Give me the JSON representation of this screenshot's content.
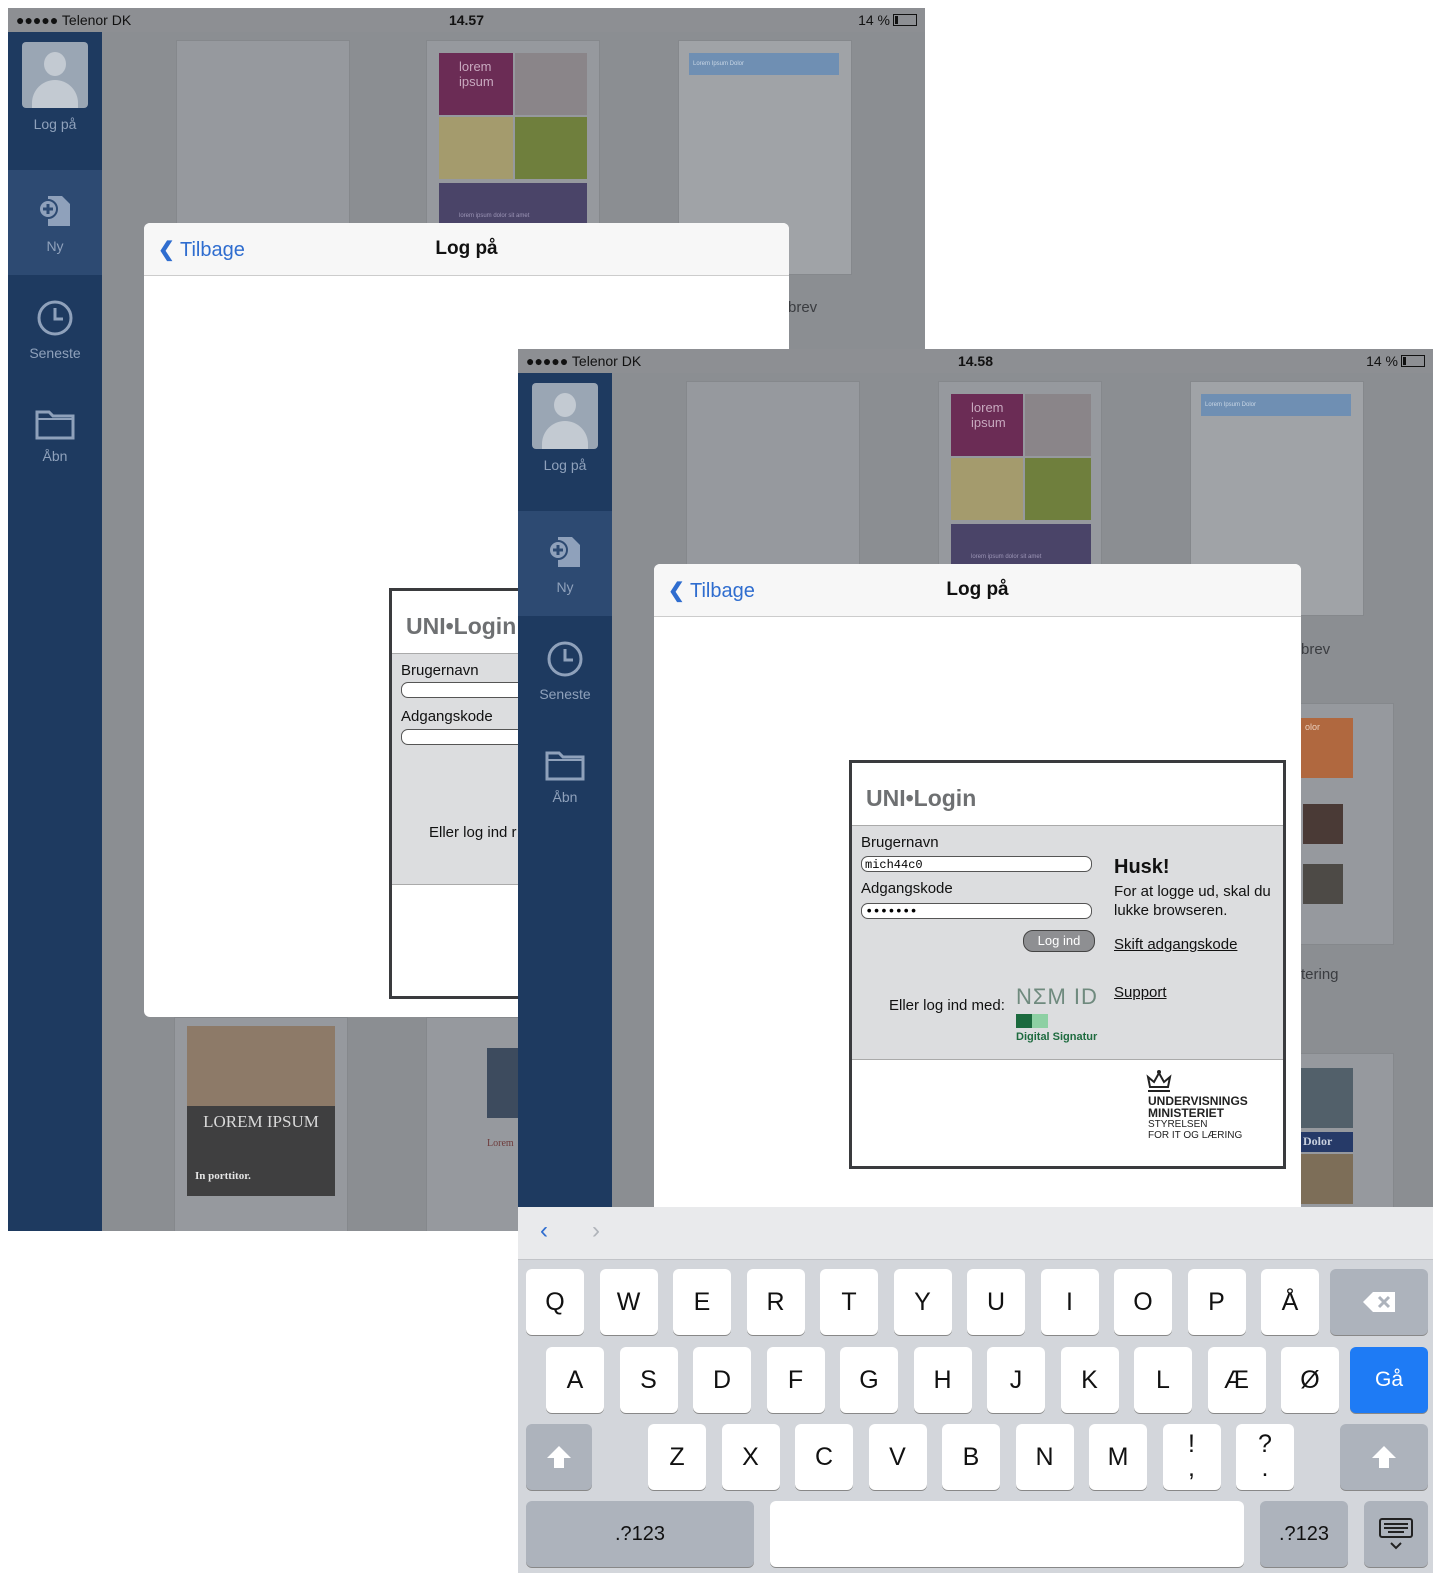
{
  "back_screenshot": {
    "status": {
      "carrier": "●●●●● Telenor DK",
      "time": "14.57",
      "battery": "14 %"
    },
    "sidebar": [
      {
        "label": "Log på",
        "icon": "avatar"
      },
      {
        "label": "Ny",
        "icon": "new-document-icon"
      },
      {
        "label": "Seneste",
        "icon": "clock-icon"
      },
      {
        "label": "Åbn",
        "icon": "folder-icon"
      }
    ],
    "thumbs": {
      "lorem": "lorem\nipsum",
      "lorem_caption": "lorem ipsum dolor sit amet",
      "doc_header": "Lorem Ipsum Dolor",
      "brev": "brev",
      "poster_title": "LOREM IPSUM",
      "poster_sub": "In porttitor.",
      "lorem2": "Lorem"
    },
    "modal": {
      "back": "Tilbage",
      "title": "Log på"
    },
    "uni": {
      "logo": "UNI•Login",
      "user_label": "Brugernavn",
      "pass_label": "Adgangskode",
      "alt": "Eller log ind r"
    }
  },
  "front_screenshot": {
    "status": {
      "carrier": "●●●●● Telenor DK",
      "time": "14.58",
      "battery": "14 %"
    },
    "sidebar": [
      {
        "label": "Log på",
        "icon": "avatar"
      },
      {
        "label": "Ny",
        "icon": "new-document-icon"
      },
      {
        "label": "Seneste",
        "icon": "clock-icon"
      },
      {
        "label": "Åbn",
        "icon": "folder-icon"
      }
    ],
    "thumbs": {
      "lorem": "lorem\nipsum",
      "lorem_caption": "lorem ipsum dolor sit amet",
      "doc_header": "Lorem Ipsum Dolor",
      "brev": "brev",
      "tering": "tering",
      "olor": "olor",
      "dolor": "Dolor"
    },
    "modal": {
      "back": "Tilbage",
      "title": "Log på"
    },
    "uni": {
      "logo": "UNI•Login",
      "user_label": "Brugernavn",
      "user_value": "mich44c0",
      "pass_label": "Adgangskode",
      "pass_value": "•••••••",
      "login_button": "Log ind",
      "husk_title": "Husk!",
      "husk_text": "For at logge ud, skal du lukke browseren.",
      "change_password": "Skift adgangskode",
      "support": "Support",
      "alt_login": "Eller log ind med:",
      "nemid": "NΣM ID",
      "digital_signatur": "Digital Signatur",
      "ministry_line1": "UNDERVISNINGS",
      "ministry_line2": "MINISTERIET",
      "ministry_line3": "STYRELSEN",
      "ministry_line4": "FOR IT OG LÆRING"
    },
    "keyboard": {
      "row1": [
        "Q",
        "W",
        "E",
        "R",
        "T",
        "Y",
        "U",
        "I",
        "O",
        "P",
        "Å"
      ],
      "row2": [
        "A",
        "S",
        "D",
        "F",
        "G",
        "H",
        "J",
        "K",
        "L",
        "Æ",
        "Ø"
      ],
      "row3": [
        "Z",
        "X",
        "C",
        "V",
        "B",
        "N",
        "M",
        "!\n,",
        "?\n."
      ],
      "go": "Gå",
      "numbers": ".?123"
    }
  }
}
